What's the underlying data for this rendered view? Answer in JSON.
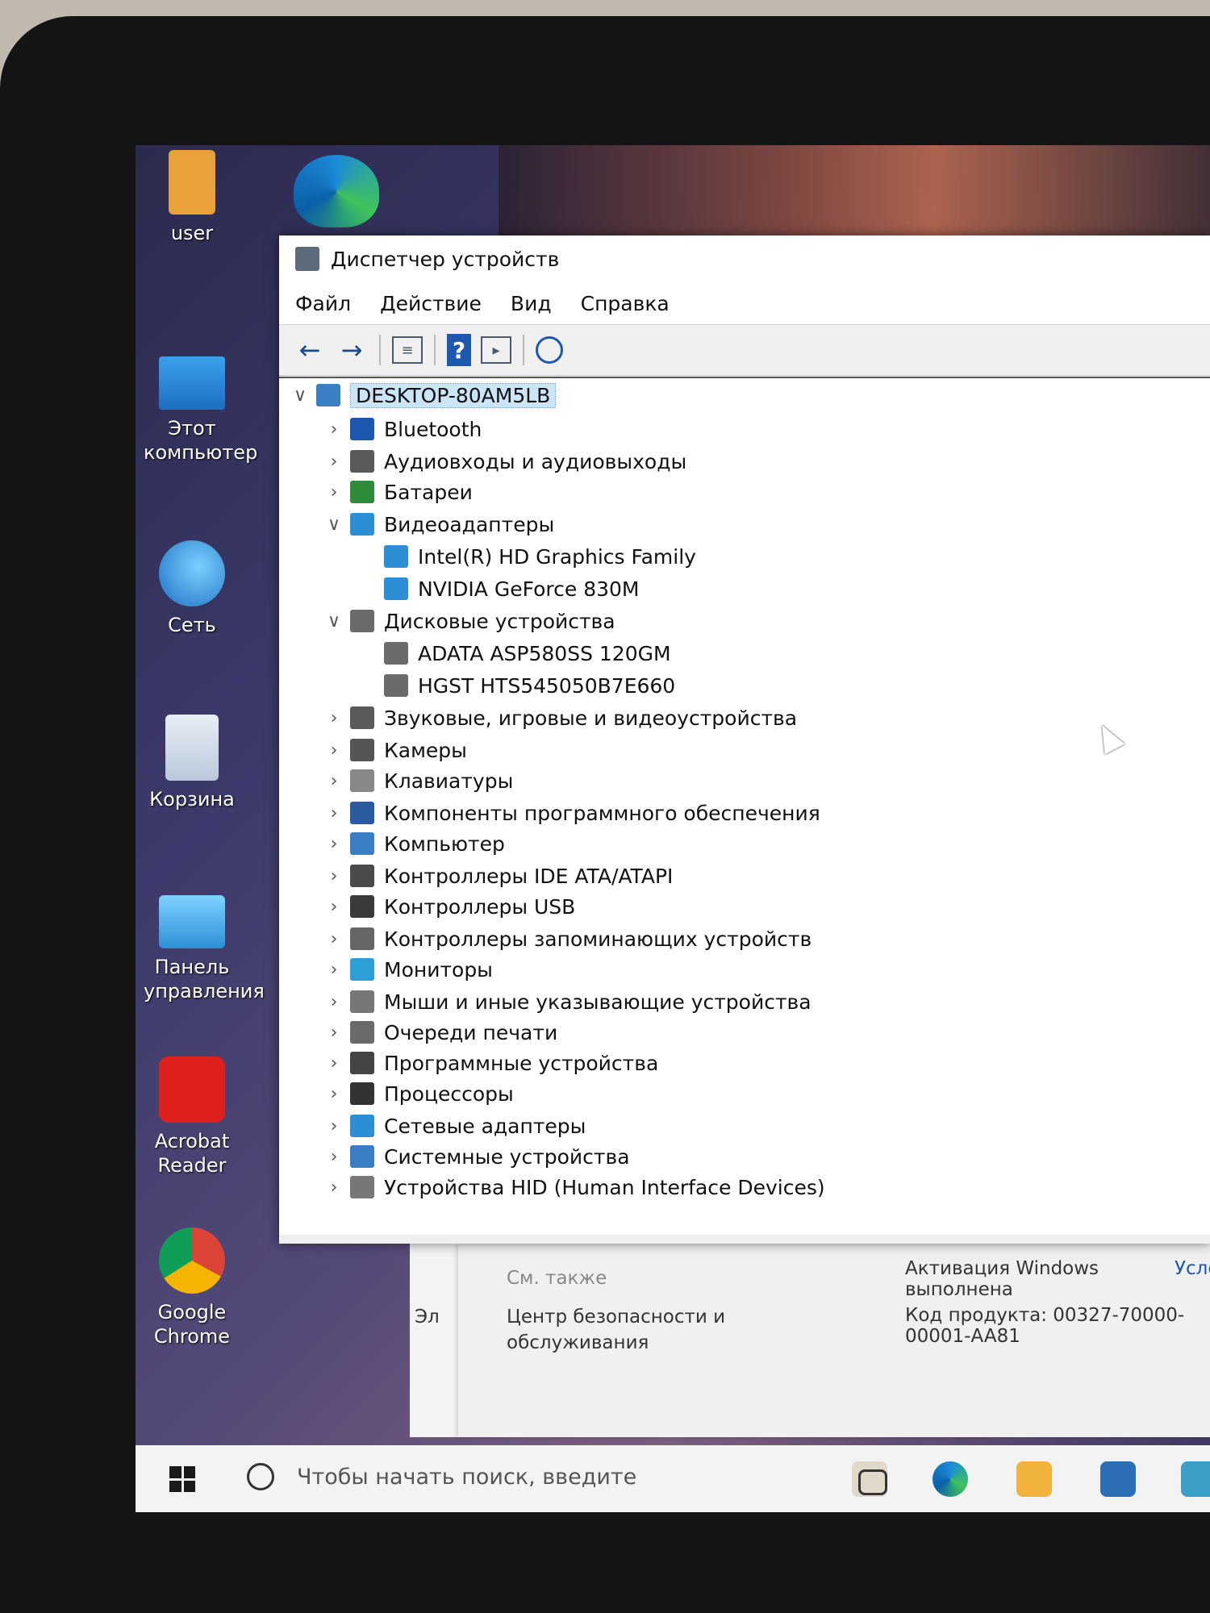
{
  "desktop": {
    "icons": [
      {
        "label": "user"
      },
      {
        "label": "Этот компьютер"
      },
      {
        "label": "Сеть"
      },
      {
        "label": "Корзина"
      },
      {
        "label": "Панель управления"
      },
      {
        "label": "Acrobat Reader"
      },
      {
        "label": "Google Chrome"
      }
    ]
  },
  "window": {
    "title": "Диспетчер устройств",
    "menu": [
      "Файл",
      "Действие",
      "Вид",
      "Справка"
    ],
    "tree": [
      {
        "label": "DESKTOP-80AM5LB",
        "level": 0,
        "expanded": true,
        "icon": "computer-icon"
      },
      {
        "label": "Bluetooth",
        "level": 1,
        "expanded": false,
        "icon": "bluetooth-icon"
      },
      {
        "label": "Аудиовходы и аудиовыходы",
        "level": 1,
        "expanded": false,
        "icon": "speaker-icon"
      },
      {
        "label": "Батареи",
        "level": 1,
        "expanded": false,
        "icon": "battery-icon"
      },
      {
        "label": "Видеоадаптеры",
        "level": 1,
        "expanded": true,
        "icon": "display-adapter-icon"
      },
      {
        "label": "Intel(R) HD Graphics Family",
        "level": 2,
        "icon": "display-adapter-icon"
      },
      {
        "label": "NVIDIA GeForce 830M",
        "level": 2,
        "icon": "display-adapter-icon"
      },
      {
        "label": "Дисковые устройства",
        "level": 1,
        "expanded": true,
        "icon": "disk-icon"
      },
      {
        "label": "ADATA ASP580SS 120GM",
        "level": 2,
        "icon": "disk-icon"
      },
      {
        "label": "HGST HTS545050B7E660",
        "level": 2,
        "icon": "disk-icon"
      },
      {
        "label": "Звуковые, игровые и видеоустройства",
        "level": 1,
        "expanded": false,
        "icon": "speaker-icon"
      },
      {
        "label": "Камеры",
        "level": 1,
        "expanded": false,
        "icon": "camera-icon"
      },
      {
        "label": "Клавиатуры",
        "level": 1,
        "expanded": false,
        "icon": "keyboard-icon"
      },
      {
        "label": "Компоненты программного обеспечения",
        "level": 1,
        "expanded": false,
        "icon": "software-component-icon"
      },
      {
        "label": "Компьютер",
        "level": 1,
        "expanded": false,
        "icon": "computer-icon"
      },
      {
        "label": "Контроллеры IDE ATA/ATAPI",
        "level": 1,
        "expanded": false,
        "icon": "ide-controller-icon"
      },
      {
        "label": "Контроллеры USB",
        "level": 1,
        "expanded": false,
        "icon": "usb-icon"
      },
      {
        "label": "Контроллеры запоминающих устройств",
        "level": 1,
        "expanded": false,
        "icon": "storage-controller-icon"
      },
      {
        "label": "Мониторы",
        "level": 1,
        "expanded": false,
        "icon": "monitor-icon"
      },
      {
        "label": "Мыши и иные указывающие устройства",
        "level": 1,
        "expanded": false,
        "icon": "mouse-icon"
      },
      {
        "label": "Очереди печати",
        "level": 1,
        "expanded": false,
        "icon": "printer-icon"
      },
      {
        "label": "Программные устройства",
        "level": 1,
        "expanded": false,
        "icon": "software-device-icon"
      },
      {
        "label": "Процессоры",
        "level": 1,
        "expanded": false,
        "icon": "processor-icon"
      },
      {
        "label": "Сетевые адаптеры",
        "level": 1,
        "expanded": false,
        "icon": "network-adapter-icon"
      },
      {
        "label": "Системные устройства",
        "level": 1,
        "expanded": false,
        "icon": "system-device-icon"
      },
      {
        "label": "Устройства HID (Human Interface Devices)",
        "level": 1,
        "expanded": false,
        "icon": "hid-icon"
      }
    ]
  },
  "background_window": {
    "see_also": "См. также",
    "security_link_line1": "Центр безопасности и",
    "security_link_line2": "обслуживания",
    "truncated_left": "Эл",
    "activation": "Активация Windows выполнена",
    "activation_link": "Усло",
    "product_code": "Код продукта:  00327-70000-00001-AA81"
  },
  "taskbar": {
    "search_placeholder": "Чтобы начать поиск, введите"
  },
  "colors": {
    "selection": "#cce4f7",
    "accent": "#1d57b0"
  }
}
